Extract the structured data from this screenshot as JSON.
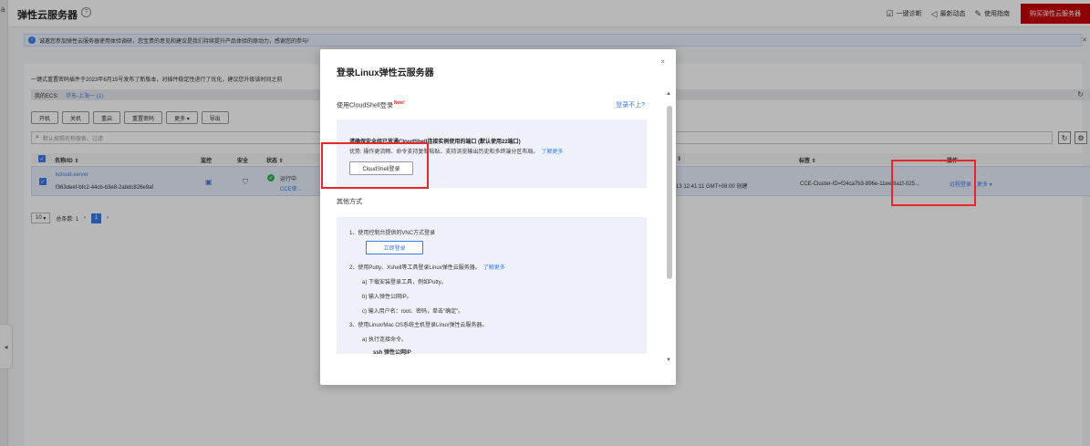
{
  "header": {
    "title": "弹性云服务器",
    "help_icon": "?",
    "actions": [
      {
        "label": "一键诊断",
        "icon": "☑"
      },
      {
        "label": "最新动态",
        "icon": "◁"
      },
      {
        "label": "使用指南",
        "icon": "✎"
      }
    ],
    "buy_button": "购买弹性云服务器"
  },
  "notice": {
    "text": "诚邀您参加弹性云服务器使用体验调研，您宝贵的意见和建议是我们持续提升产品体验的原动力，感谢您的参与!"
  },
  "main": {
    "upgrade_text": "一键式重置密码插件于2023年6月15号发布了新版本，对插件稳定性进行了优化，建议您升级该时间之前",
    "ecs_label": "我的ECS:",
    "region": "华东-上海一 (1)",
    "toolbar": [
      "开机",
      "关机",
      "重启",
      "重置密码",
      "更多 ▾",
      "导出"
    ],
    "search_placeholder": "默认按照名称搜索、过滤",
    "table": {
      "headers": {
        "name": "名称/ID ⇕",
        "monitor": "监控",
        "security": "安全",
        "status": "状态 ⇕",
        "created": "⇕",
        "tag": "标签 ⇕",
        "ops": "操作"
      },
      "row": {
        "name": "kcloud-server",
        "id": "f363deef-bfc2-44cb-b3e8-2abdc826e9af",
        "status": "运行中",
        "cce": "CCE使...",
        "created": "13 12:41:11 GMT+08:00 创建",
        "tag": "CCE-Cluster-ID=f24ca7b3-896e-11ee-8a1f-025...",
        "remote_login": "远程登录",
        "more": "更多 ▾"
      }
    },
    "pager": {
      "size": "10",
      "total": "总条数: 1",
      "prev": "‹",
      "page": "1",
      "next": "›"
    }
  },
  "modal": {
    "title": "登录Linux弹性云服务器",
    "close": "×",
    "cloudshell_label": "使用CloudShell登录",
    "new_badge": "New!",
    "cant_login": "登录不上?",
    "cloudshell_bold": "请确保安全组已放通CloudShell连接实例使用的端口 (默认使用22端口)",
    "cloudshell_desc": "优势: 操作更流畅、命令支持复制粘贴、支持浏览输出历史和多终端分区布局。",
    "learn_more": "了解更多",
    "cloudshell_button": "CloudShell登录",
    "other_label": "其他方式",
    "other": {
      "l1": "1、使用控制台提供的VNC方式登录",
      "vnc_button": "立即登录",
      "l2": "2、使用Putty、Xshell等工具登录Linux弹性云服务器。",
      "l2a": "a) 下载安装登录工具，例如Putty。",
      "l2b": "b) 输入弹性公网IP。",
      "l2c": "c) 输入用户名：root、密码，单击\"确定\"。",
      "l3": "3、使用Linux/Mac OS系统主机登录Linux弹性云服务器。",
      "l3a": "a) 执行连接命令。",
      "ssh": "ssh 弹性公网IP"
    }
  }
}
